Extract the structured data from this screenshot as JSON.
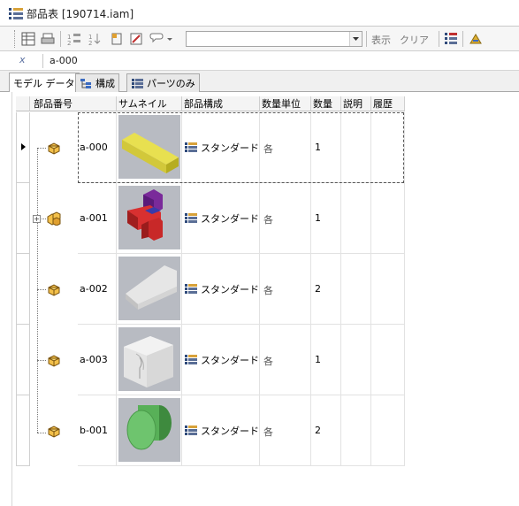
{
  "window": {
    "title": "部品表 [190714.iam]"
  },
  "toolbar": {
    "view_label": "表示",
    "clear_label": "クリア",
    "combo_value": ""
  },
  "search": {
    "fx_label": "x",
    "value": "a-000"
  },
  "tabs": [
    {
      "label": "モデル データ",
      "active": true
    },
    {
      "label": "構成",
      "active": false
    },
    {
      "label": "パーツのみ",
      "active": false
    }
  ],
  "table": {
    "columns": [
      "部品番号",
      "サムネイル",
      "部品構成",
      "数量単位",
      "数量",
      "説明",
      "履歴"
    ],
    "sort_indicator": "△",
    "rows": [
      {
        "part_number": "a-000",
        "thumbnail": "yellow-bar",
        "structure": "スタンダード",
        "unit": "各",
        "qty": "1",
        "description": "",
        "history": "",
        "selected": true,
        "icon": "part-icon"
      },
      {
        "part_number": "a-001",
        "thumbnail": "red-blue-assembly",
        "structure": "スタンダード",
        "unit": "各",
        "qty": "1",
        "description": "",
        "history": "",
        "selected": false,
        "icon": "assembly-icon"
      },
      {
        "part_number": "a-002",
        "thumbnail": "gray-wedge",
        "structure": "スタンダード",
        "unit": "各",
        "qty": "2",
        "description": "",
        "history": "",
        "selected": false,
        "icon": "part-icon"
      },
      {
        "part_number": "a-003",
        "thumbnail": "gray-notch-block",
        "structure": "スタンダード",
        "unit": "各",
        "qty": "1",
        "description": "",
        "history": "",
        "selected": false,
        "icon": "part-icon"
      },
      {
        "part_number": "b-001",
        "thumbnail": "green-cylinder",
        "structure": "スタンダード",
        "unit": "各",
        "qty": "2",
        "description": "",
        "history": "",
        "selected": false,
        "icon": "part-icon"
      }
    ]
  }
}
